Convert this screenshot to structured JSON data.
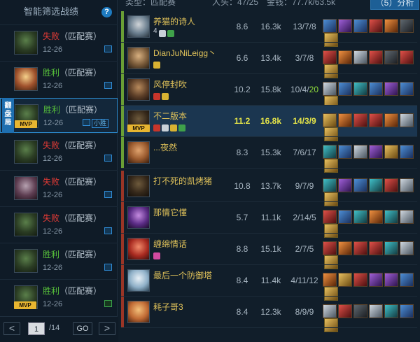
{
  "sidebar": {
    "title": "智能筛选战绩",
    "help": "?",
    "flip_badge": "翻盘局",
    "matches": [
      {
        "result": "失败",
        "mode": "（匹配赛）",
        "date": "12-26",
        "outcome": "lose",
        "mvp": false,
        "champ": "c1"
      },
      {
        "result": "胜利",
        "mode": "（匹配赛）",
        "date": "12-26",
        "outcome": "win",
        "mvp": false,
        "champ": "c2"
      },
      {
        "result": "胜利",
        "mode": "（匹配赛）",
        "date": "12-26",
        "outcome": "win",
        "mvp": true,
        "champ": "c1",
        "tag": "小胜",
        "selected": true
      },
      {
        "result": "失败",
        "mode": "（匹配赛）",
        "date": "12-26",
        "outcome": "lose",
        "mvp": false,
        "champ": "c1"
      },
      {
        "result": "失败",
        "mode": "（匹配赛）",
        "date": "12-26",
        "outcome": "lose",
        "mvp": false,
        "champ": "c11"
      },
      {
        "result": "失败",
        "mode": "（匹配赛）",
        "date": "12-26",
        "outcome": "lose",
        "mvp": false,
        "champ": "c1"
      },
      {
        "result": "胜利",
        "mode": "（匹配赛）",
        "date": "12-26",
        "outcome": "win",
        "mvp": false,
        "champ": "c1"
      },
      {
        "result": "胜利",
        "mode": "（匹配赛）",
        "date": "12-26",
        "outcome": "win",
        "mvp": true,
        "champ": "c1"
      }
    ],
    "pager": {
      "prev": "<",
      "page": "1",
      "total": "/14",
      "go": "GO",
      "next": ">"
    }
  },
  "topbar": {
    "type_label": "类型：匹配赛",
    "kills_label": "人头：47/25",
    "gold_label": "金钱：77.7k/63.5k",
    "analyze_button": "（5）分析"
  },
  "players": [
    {
      "team": "blue",
      "name": "养猫的诗人",
      "kda": "8.6",
      "gold": "16.3k",
      "score": "13/7/8",
      "champ": "c3",
      "badges": [
        "b-white",
        "b-green"
      ],
      "badge_text": "4",
      "items": [
        "i-blue",
        "i-purple",
        "i-blue",
        "i-red",
        "i-orange",
        "i-dark",
        "i-gold"
      ]
    },
    {
      "team": "blue",
      "name": "DianJuNiLeigg丶",
      "kda": "6.6",
      "gold": "13.4k",
      "score": "3/7/8",
      "champ": "c4",
      "badges": [
        "b-yellow"
      ],
      "items": [
        "i-red",
        "i-orange",
        "i-silver",
        "i-red",
        "i-dark",
        "i-red",
        "i-gold"
      ]
    },
    {
      "team": "blue",
      "name": "风停封吹",
      "kda": "10.2",
      "gold": "15.8k",
      "score": "10/4/",
      "score_hl": "20",
      "champ": "c5",
      "badges": [
        "b-red",
        "b-yellow"
      ],
      "items": [
        "i-silver",
        "i-blue",
        "i-teal",
        "i-blue",
        "i-purple",
        "i-blue",
        "i-gold"
      ]
    },
    {
      "team": "blue",
      "name": "不二版本",
      "kda": "11.2",
      "gold": "16.8k",
      "score": "14/3/9",
      "champ": "c6",
      "me": true,
      "mvp": true,
      "badges": [
        "b-red",
        "b-white",
        "b-yellow",
        "b-green"
      ],
      "items": [
        "i-gold",
        "i-orange",
        "i-red",
        "i-red",
        "i-orange",
        "i-silver",
        "i-gold"
      ]
    },
    {
      "team": "blue",
      "name": "...夜然",
      "kda": "8.3",
      "gold": "15.3k",
      "score": "7/6/17",
      "champ": "c12",
      "badges": [],
      "items": [
        "i-teal",
        "i-blue",
        "i-silver",
        "i-purple",
        "i-gold",
        "i-blue",
        "i-gold"
      ]
    },
    {
      "team": "red",
      "name": "打不死的凯烤猪",
      "kda": "10.8",
      "gold": "13.7k",
      "score": "9/7/9",
      "champ": "c6",
      "badges": [],
      "items": [
        "i-teal",
        "i-purple",
        "i-blue",
        "i-teal",
        "i-red",
        "i-silver",
        "i-gold"
      ]
    },
    {
      "team": "red",
      "name": "那情它懂",
      "kda": "5.7",
      "gold": "11.1k",
      "score": "2/14/5",
      "champ": "c7",
      "badges": [],
      "items": [
        "i-red",
        "i-blue",
        "i-teal",
        "i-orange",
        "i-teal",
        "i-silver",
        "i-gold"
      ]
    },
    {
      "team": "red",
      "name": "缠绵情话",
      "kda": "8.8",
      "gold": "15.1k",
      "score": "2/7/5",
      "champ": "c8",
      "badges": [
        "b-pink"
      ],
      "items": [
        "i-red",
        "i-orange",
        "i-red",
        "i-red",
        "i-teal",
        "i-silver",
        "i-gold"
      ]
    },
    {
      "team": "red",
      "name": "最后一个防御塔",
      "kda": "8.4",
      "gold": "11.4k",
      "score": "4/11/12",
      "champ": "c9",
      "badges": [],
      "items": [
        "i-orange",
        "i-gold",
        "i-red",
        "i-purple",
        "i-purple",
        "i-blue",
        "i-gold"
      ]
    },
    {
      "team": "red",
      "name": "耗子哥3",
      "kda": "8.4",
      "gold": "12.3k",
      "score": "8/9/9",
      "champ": "c10",
      "badges": [],
      "items": [
        "i-silver",
        "i-red",
        "i-dark",
        "i-silver",
        "i-teal",
        "i-blue",
        "i-gold"
      ]
    }
  ]
}
